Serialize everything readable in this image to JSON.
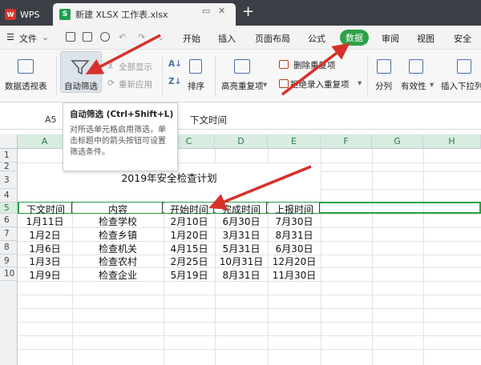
{
  "titlebar": {
    "app_label": "WPS",
    "file_tab": "新建 XLSX 工作表.xlsx",
    "new_tab": "+"
  },
  "menubar": {
    "file_menu": "文件",
    "items": [
      "开始",
      "插入",
      "页面布局",
      "公式",
      "数据",
      "审阅",
      "视图",
      "安全"
    ],
    "active": "数据"
  },
  "ribbon": {
    "pivot": "数据透视表",
    "autofilter": "自动筛选",
    "show_all": "全部显示",
    "reapply": "重新应用",
    "sort": "排序",
    "highlight_dup": "高亮重复项",
    "delete_dup": "删除重复项",
    "reject_dup": "拒绝录入重复项",
    "split": "分列",
    "validity": "有效性",
    "insert_dropdown": "插入下拉列"
  },
  "tooltip": {
    "title": "自动筛选 (Ctrl+Shift+L)",
    "body": "对所选单元格启用筛选，单击标题中的箭头按钮可设置筛选条件。"
  },
  "formula_bar": {
    "cell_ref": "A5",
    "content": "下文时间"
  },
  "columns": [
    "A",
    "B",
    "C",
    "D",
    "E",
    "F",
    "G",
    "H"
  ],
  "rows": [
    "1",
    "2",
    "3",
    "4",
    "5",
    "6",
    "7",
    "8",
    "9",
    "10"
  ],
  "sheet": {
    "title": "2019年安全检查计划",
    "headers": [
      "下文时间",
      "内容",
      "开始时间",
      "完成时间",
      "上报时间"
    ],
    "data": [
      [
        "1月11日",
        "检查学校",
        "2月10日",
        "6月30日",
        "7月30日"
      ],
      [
        "1月2日",
        "检查乡镇",
        "1月20日",
        "3月31日",
        "8月31日"
      ],
      [
        "1月6日",
        "检查机关",
        "4月15日",
        "5月31日",
        "6月30日"
      ],
      [
        "1月3日",
        "检查农村",
        "2月25日",
        "10月31日",
        "12月20日"
      ],
      [
        "1月9日",
        "检查企业",
        "5月19日",
        "8月31日",
        "11月30日"
      ]
    ]
  },
  "colors": {
    "accent_green": "#2ba245",
    "arrow_red": "#d6302b",
    "titlebar_bg": "#3b3f45"
  }
}
